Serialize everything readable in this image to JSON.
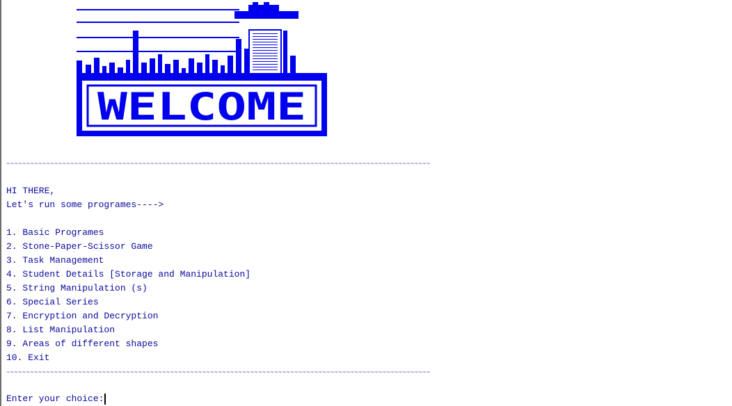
{
  "banner": {
    "word": "WELCOME",
    "color": "#0000ee"
  },
  "divider_text": "~~~~~~~~~~~~~~~~~~~~~~~~~~~~~~~~~~~~~~~~~~~~~~~~~~~~~~~~~~~~~~~~~~~~~~~~~~~~~~~~~~~~~~~~~~~~~~~~~~~~~~~~~~",
  "greeting": {
    "line1": "HI THERE,",
    "line2": "Let's run some programes---->"
  },
  "menu": [
    "1. Basic Programes",
    "2. Stone-Paper-Scissor Game",
    "3. Task Management",
    "4. Student Details [Storage and Manipulation]",
    "5. String Manipulation (s)",
    "6. Special Series",
    "7. Encryption and Decryption",
    "8. List Manipulation",
    "9. Areas of different shapes",
    "10. Exit"
  ],
  "prompt": "Enter your choice:",
  "text_color": "#0a0a9c"
}
